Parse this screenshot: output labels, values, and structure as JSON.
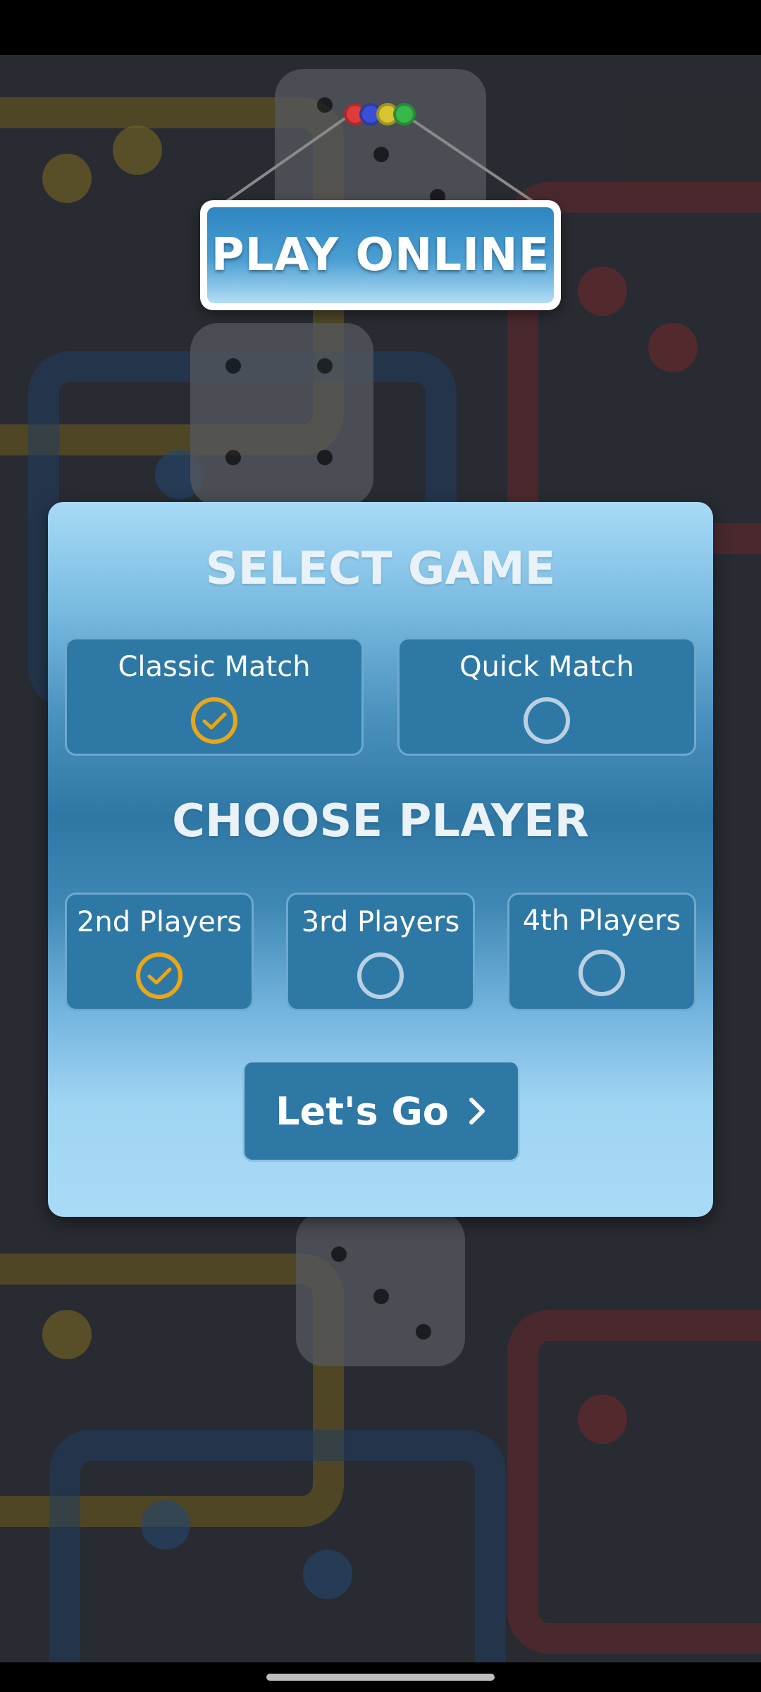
{
  "sign": {
    "title": "PLAY ONLINE",
    "bead_colors": [
      "#e03a3a",
      "#3b4fd6",
      "#d6c431",
      "#38b84a"
    ]
  },
  "select_game": {
    "heading": "SELECT GAME",
    "options": [
      {
        "label": "Classic Match",
        "selected": true
      },
      {
        "label": "Quick Match",
        "selected": false
      }
    ]
  },
  "choose_player": {
    "heading": "CHOOSE PLAYER",
    "options": [
      {
        "label": "2nd Players",
        "selected": true
      },
      {
        "label": "3rd Players",
        "selected": false
      },
      {
        "label": "4th Players",
        "selected": false
      }
    ]
  },
  "action": {
    "label": "Let's Go",
    "icon": "chevron-right-icon"
  },
  "colors": {
    "accent_check": "#e8a71a",
    "panel_button": "#2e78a6"
  }
}
